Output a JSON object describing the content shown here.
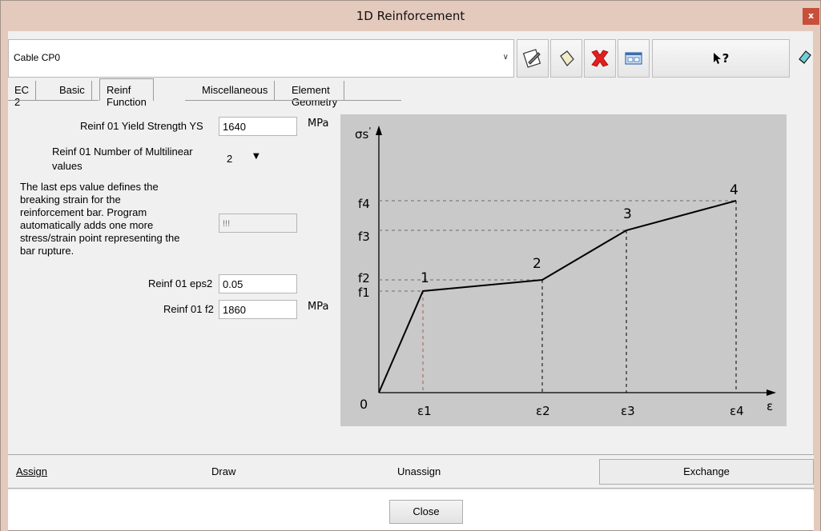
{
  "window": {
    "title": "1D Reinforcement",
    "close_label": "x"
  },
  "combo": {
    "value": "Cable CP0"
  },
  "toolbar": {
    "help_label": "?"
  },
  "tabs": [
    "EC 2",
    "Basic",
    "Reinf Function",
    "Miscellaneous",
    "Element Geometry"
  ],
  "form": {
    "yield_label": "Reinf 01 Yield Strength YS",
    "yield_value": "1640",
    "yield_unit": "MPa",
    "multilinear_label_1": "Reinf 01 Number of Multilinear",
    "multilinear_label_2": "values",
    "multilinear_value": "2",
    "note_lines": [
      "The last eps value defines the",
      "breaking strain for the",
      "reinforcement bar. Program",
      "automatically adds one more",
      "stress/strain point representing the",
      "bar rupture."
    ],
    "note_field_value": "!!!",
    "eps2_label": "Reinf 01 eps2",
    "eps2_value": "0.05",
    "f2_label": "Reinf 01 f2",
    "f2_value": "1860",
    "f2_unit": "MPa"
  },
  "diagram": {
    "y_axis_label": "σs",
    "y_axis_label_sup": "'",
    "x_axis_label": "ε",
    "origin_label": "0",
    "x_ticks": [
      "ε1",
      "ε2",
      "ε3",
      "ε4"
    ],
    "y_ticks": [
      "f1",
      "f2",
      "f3",
      "f4"
    ],
    "point_labels": [
      "1",
      "2",
      "3",
      "4"
    ]
  },
  "bottom": {
    "assign": "Assign",
    "draw": "Draw",
    "unassign": "Unassign",
    "exchange": "Exchange"
  },
  "footer": {
    "close": "Close"
  },
  "colors": {
    "titlebar": "#e4cabd",
    "close_red": "#c84f3a",
    "chart_bg": "#c9c9c9",
    "delete_red": "#e02020"
  }
}
